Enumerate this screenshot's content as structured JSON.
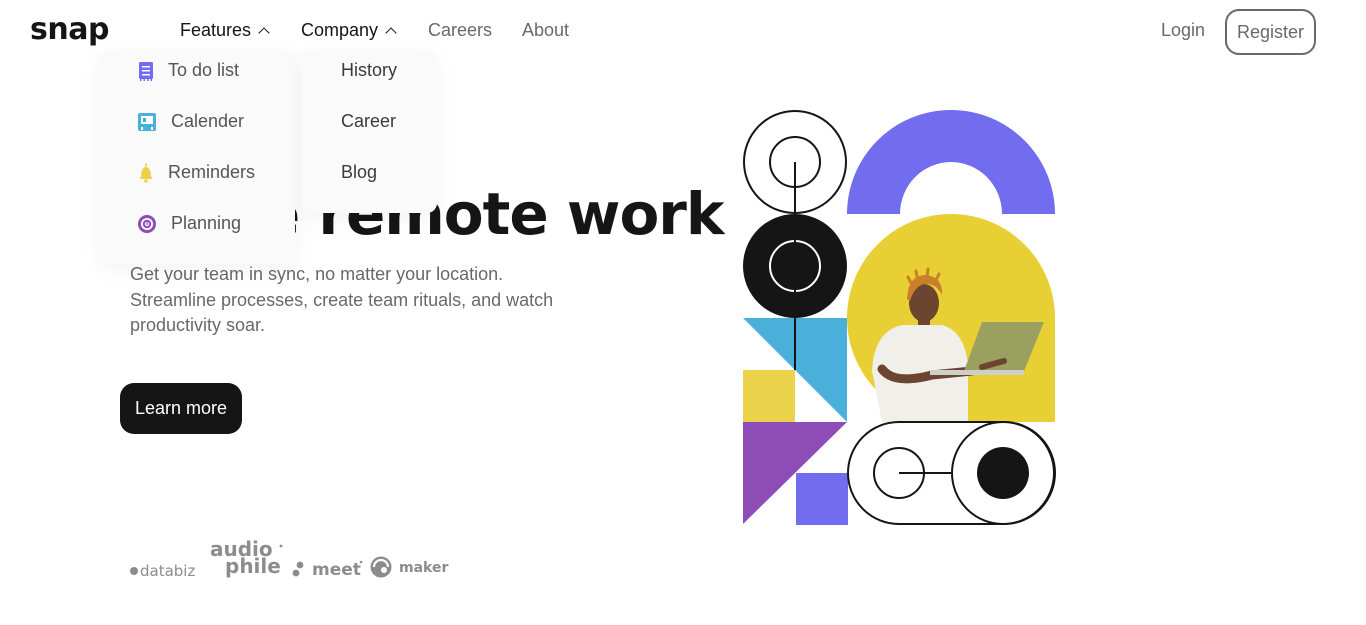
{
  "brand": {
    "logo": "snap"
  },
  "nav": {
    "items": [
      {
        "label": "Features",
        "has_dropdown": true,
        "expanded": true
      },
      {
        "label": "Company",
        "has_dropdown": true,
        "expanded": true
      },
      {
        "label": "Careers"
      },
      {
        "label": "About"
      }
    ],
    "login": "Login",
    "register": "Register"
  },
  "features_menu": [
    {
      "label": "To do list",
      "icon": "todo-list-icon"
    },
    {
      "label": "Calender",
      "icon": "calendar-icon"
    },
    {
      "label": "Reminders",
      "icon": "reminders-bell-icon"
    },
    {
      "label": "Planning",
      "icon": "planning-icon"
    }
  ],
  "company_menu": [
    {
      "label": "History"
    },
    {
      "label": "Career"
    },
    {
      "label": "Blog"
    }
  ],
  "hero": {
    "title": "Make remote work",
    "description": "Get your team in sync, no matter your location. Streamline processes, create team rituals, and watch productivity soar.",
    "cta": "Learn more"
  },
  "clients": [
    {
      "name": "databiz"
    },
    {
      "name": "audiophile"
    },
    {
      "name": "meet"
    },
    {
      "name": "maker"
    }
  ],
  "colors": {
    "text_dark": "#151515",
    "text_gray": "#696969",
    "purple": "#726cee",
    "blue": "#4bafdc",
    "yellow": "#ebd24b",
    "violet": "#8e4cb6",
    "hero_bg_yellow": "#e8cf33"
  }
}
